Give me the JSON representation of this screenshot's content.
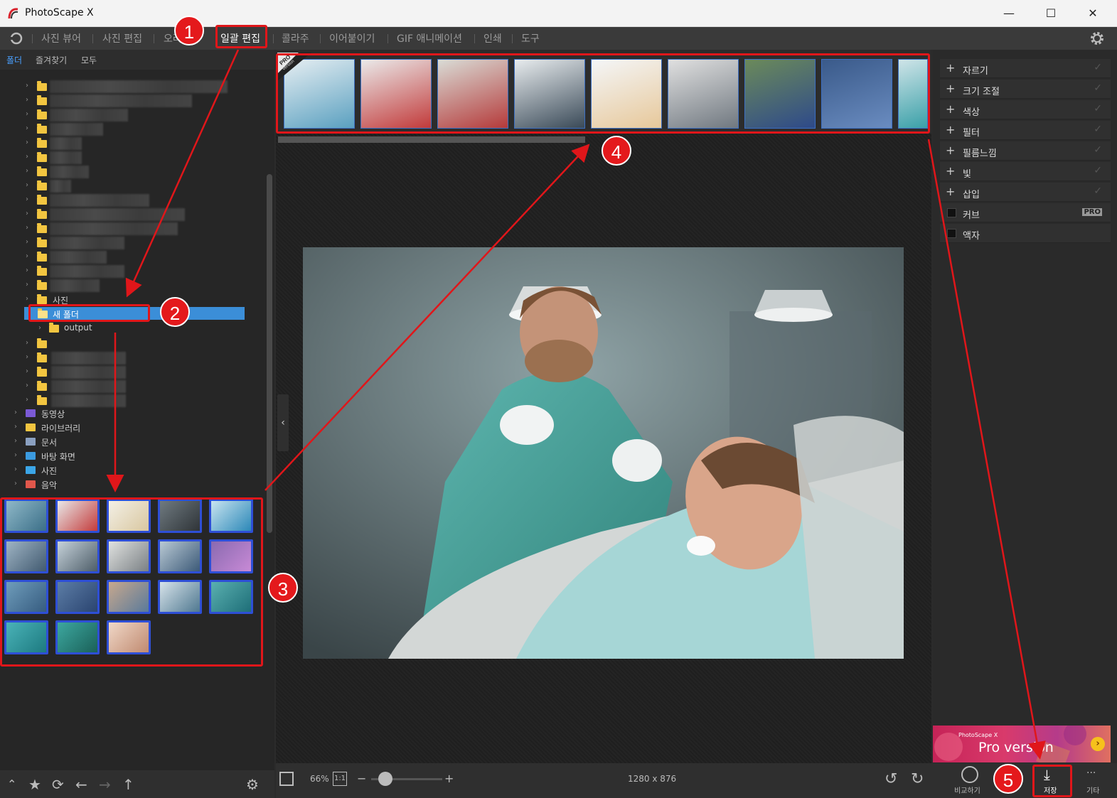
{
  "titlebar": {
    "title": "PhotoScape X",
    "minimize": "—",
    "maximize": "☐",
    "close": "✕"
  },
  "menu": {
    "items": [
      "사진 뷰어",
      "사진 편집",
      "오려",
      "일괄 편집",
      "콜라주",
      "이어붙이기",
      "GIF 애니메이션",
      "인쇄",
      "도구"
    ],
    "active_label": "일괄 편집"
  },
  "left_panel": {
    "tabs": [
      "폴더",
      "즐겨찾기",
      "모두"
    ],
    "tree_folder_partial": "사진",
    "selected_folder": "새 폴더",
    "child_folder": "output",
    "library_items": [
      "동영상",
      "라이브러리",
      "문서",
      "바탕 화면",
      "사진",
      "음악"
    ]
  },
  "filmstrip": {
    "pro_badge": "PRO",
    "pro_sub": "Version"
  },
  "right_panel": {
    "items": [
      {
        "label": "자르기",
        "kind": "plus"
      },
      {
        "label": "크기 조절",
        "kind": "plus"
      },
      {
        "label": "색상",
        "kind": "plus"
      },
      {
        "label": "필터",
        "kind": "plus"
      },
      {
        "label": "필름느낌",
        "kind": "plus"
      },
      {
        "label": "빛",
        "kind": "plus"
      },
      {
        "label": "삽입",
        "kind": "plus"
      },
      {
        "label": "커브",
        "kind": "checkbox",
        "pro": "PRO"
      },
      {
        "label": "액자",
        "kind": "checkbox"
      }
    ],
    "banner_small": "PhotoScape X",
    "banner_big": "Pro version"
  },
  "bottom_bar": {
    "zoom": "66%",
    "one_to_one": "1:1",
    "zoom_minus": "−",
    "zoom_plus": "+",
    "zoom_level": 0.2,
    "dimensions": "1280 x 876",
    "compare_label": "비교하기",
    "save_label": "저장",
    "more_label": "기타",
    "more_dots": "···"
  },
  "annotations": {
    "badges": [
      "1",
      "2",
      "3",
      "4",
      "5"
    ],
    "color": "#e0161a"
  },
  "colors": {
    "selection": "#3b8ed8",
    "accent": "#4aa0ff",
    "thumb_border": "#2e4fd6",
    "folder": "#f2c540"
  }
}
